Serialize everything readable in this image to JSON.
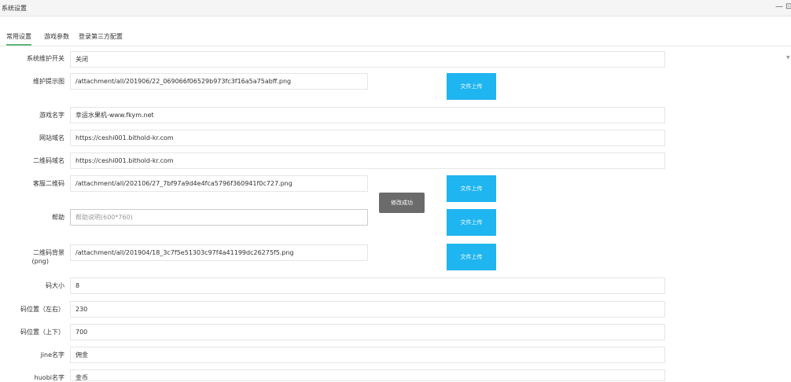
{
  "window": {
    "title": "系统设置",
    "minimize": "—",
    "restore": "⊡"
  },
  "tabs": [
    {
      "label": "常用设置"
    },
    {
      "label": "游戏参数"
    },
    {
      "label": "登录第三方配置"
    }
  ],
  "form": {
    "maintenance": {
      "label": "系统维护开关",
      "value": "关闭"
    },
    "maintenance_image": {
      "label": "维护提示图",
      "value": "/attachment/all/201906/22_069066f06529b973fc3f16a5a75abff.png"
    },
    "game_name": {
      "label": "游戏名字",
      "value": "幸运水果机-www.fkym.net"
    },
    "site_domain": {
      "label": "网站域名",
      "value": "https://ceshi001.bithold-kr.com"
    },
    "qr_domain": {
      "label": "二维码域名",
      "value": "https://ceshi001.bithold-kr.com"
    },
    "service_qr": {
      "label": "客服二维码",
      "value": "/attachment/all/202106/27_7bf97a9d4e4fca5796f360941f0c727.png"
    },
    "help": {
      "label": "帮助",
      "placeholder": "帮助说明(600*760)"
    },
    "qr_background": {
      "label_line1": "二维码背景",
      "label_line2": "(png)",
      "value": "/attachment/all/201904/18_3c7f5e51303c97f4a41199dc26275f5.png"
    },
    "code_size": {
      "label": "码大小",
      "value": "8"
    },
    "code_pos_x": {
      "label": "码位置（左右）",
      "value": "230"
    },
    "code_pos_y": {
      "label": "码位置（上下）",
      "value": "700"
    },
    "jine_name": {
      "label": "jine名字",
      "value": "佣金"
    },
    "huobi_name": {
      "label": "huobi名字",
      "value": "金币"
    }
  },
  "upload_label": "文件上传",
  "toast": "修改成功"
}
